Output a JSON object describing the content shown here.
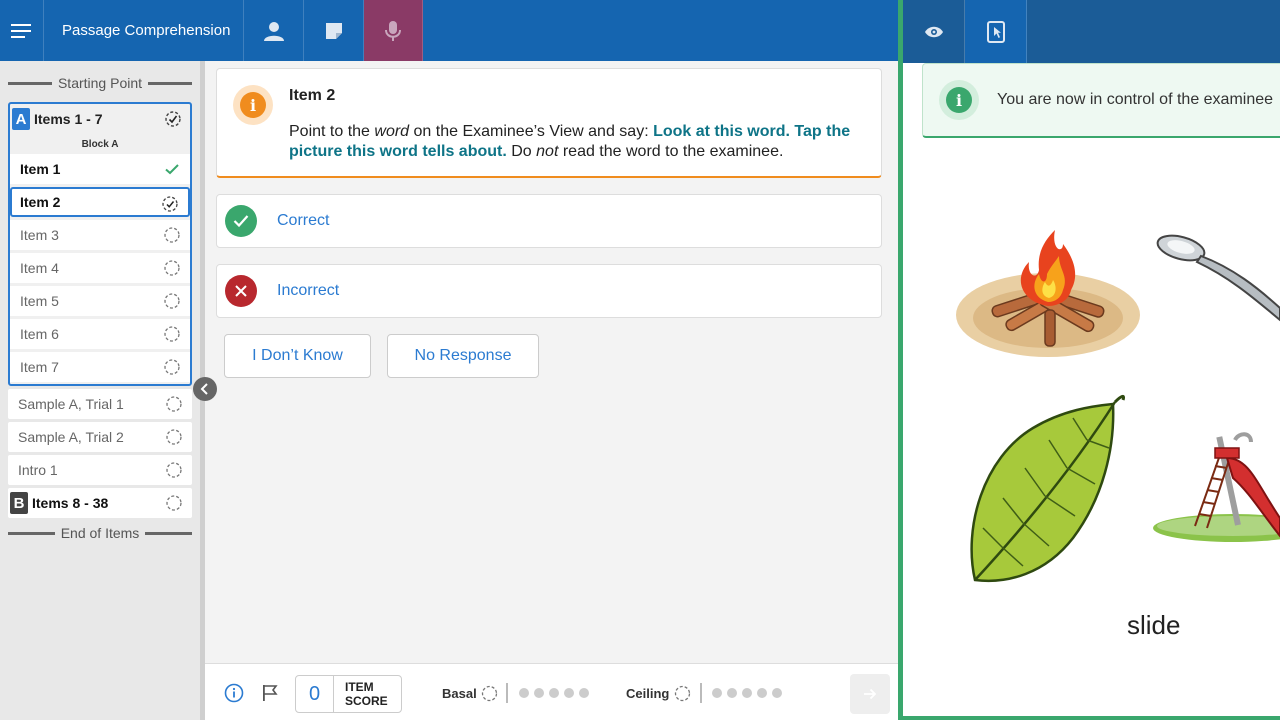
{
  "header": {
    "title": "Passage Comprehension",
    "icons": [
      "menu-icon",
      "person-icon",
      "note-icon",
      "microphone-icon"
    ]
  },
  "sidebar": {
    "start_label": "Starting Point",
    "end_label": "End of Items",
    "block_a": {
      "letter": "A",
      "title": "Items 1 - 7",
      "subtitle": "Block A",
      "items": [
        {
          "label": "Item 1",
          "status": "complete"
        },
        {
          "label": "Item 2",
          "status": "in-progress"
        },
        {
          "label": "Item 3",
          "status": "not-started"
        },
        {
          "label": "Item 4",
          "status": "not-started"
        },
        {
          "label": "Item 5",
          "status": "not-started"
        },
        {
          "label": "Item 6",
          "status": "not-started"
        },
        {
          "label": "Item 7",
          "status": "not-started"
        }
      ]
    },
    "extra_items": [
      {
        "label": "Sample A, Trial 1"
      },
      {
        "label": "Sample A, Trial 2"
      },
      {
        "label": "Intro 1"
      }
    ],
    "block_b": {
      "letter": "B",
      "title": "Items 8 - 38"
    }
  },
  "prompt": {
    "title": "Item 2",
    "text_1": "Point to the ",
    "text_word": "word",
    "text_2": " on the Examinee’s View and say: ",
    "text_strong": "Look at this word. Tap the picture this word tells about.",
    "text_3": " Do ",
    "text_not": "not",
    "text_4": " read the word to the examinee."
  },
  "answers": {
    "correct": "Correct",
    "incorrect": "Incorrect"
  },
  "options": {
    "dont_know": "I Don’t Know",
    "no_response": "No Response"
  },
  "bottom": {
    "item_score_value": "0",
    "item_score_line1": "ITEM",
    "item_score_line2": "SCORE",
    "basal_label": "Basal",
    "ceiling_label": "Ceiling"
  },
  "examinee": {
    "notice": "You are now in control of the examinee",
    "word": "slide",
    "pictures": [
      "campfire",
      "spoon",
      "leaf",
      "slide"
    ]
  },
  "colors": {
    "primary_blue": "#1565b0",
    "accent_orange": "#f08c1e",
    "success_green": "#3aa76d",
    "error_red": "#b8282e",
    "mic_active": "#8a3a66",
    "text_teal": "#0e7487"
  }
}
